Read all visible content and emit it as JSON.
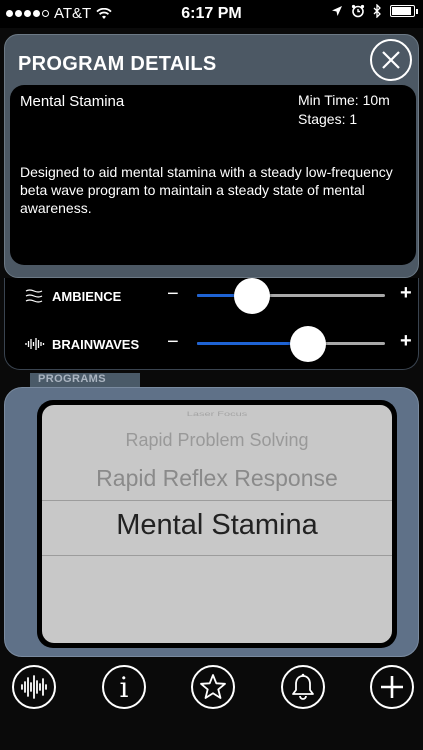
{
  "status_bar": {
    "carrier": "AT&T",
    "time": "6:17 PM",
    "signal_bars": 4,
    "battery_level": 0.9
  },
  "details": {
    "title": "PROGRAM DETAILS",
    "program_name": "Mental Stamina",
    "min_time": "Min Time: 10m",
    "stages": "Stages: 1",
    "description": "Designed to aid mental stamina with a steady low-frequency beta wave program to maintain a steady state of mental awareness."
  },
  "sliders": [
    {
      "label": "AMBIENCE",
      "minus": "−",
      "plus": "+",
      "value": 0.29
    },
    {
      "label": "BRAINWAVES",
      "minus": "−",
      "plus": "+",
      "value": 0.59
    }
  ],
  "programs": {
    "label": "PROGRAMS",
    "items": [
      "Laser Focus",
      "Rapid Problem Solving",
      "Rapid Reflex Response",
      "Mental Stamina"
    ],
    "selected": "Mental Stamina"
  },
  "toolbar": {
    "info_label": "i"
  },
  "colors": {
    "accent": "#1e63d4",
    "panel": "#4c5864",
    "programs_panel": "#5f7188"
  }
}
